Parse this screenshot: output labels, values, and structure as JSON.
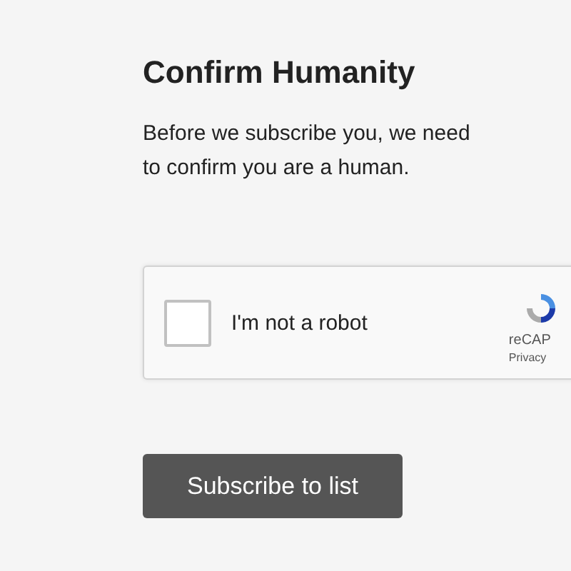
{
  "heading": "Confirm Humanity",
  "intro": "Before we subscribe you, we need to confirm you are a human.",
  "captcha": {
    "label": "I'm not a robot",
    "checked": false,
    "brand": "reCAP",
    "links": "Privacy"
  },
  "button": "Subscribe to list"
}
